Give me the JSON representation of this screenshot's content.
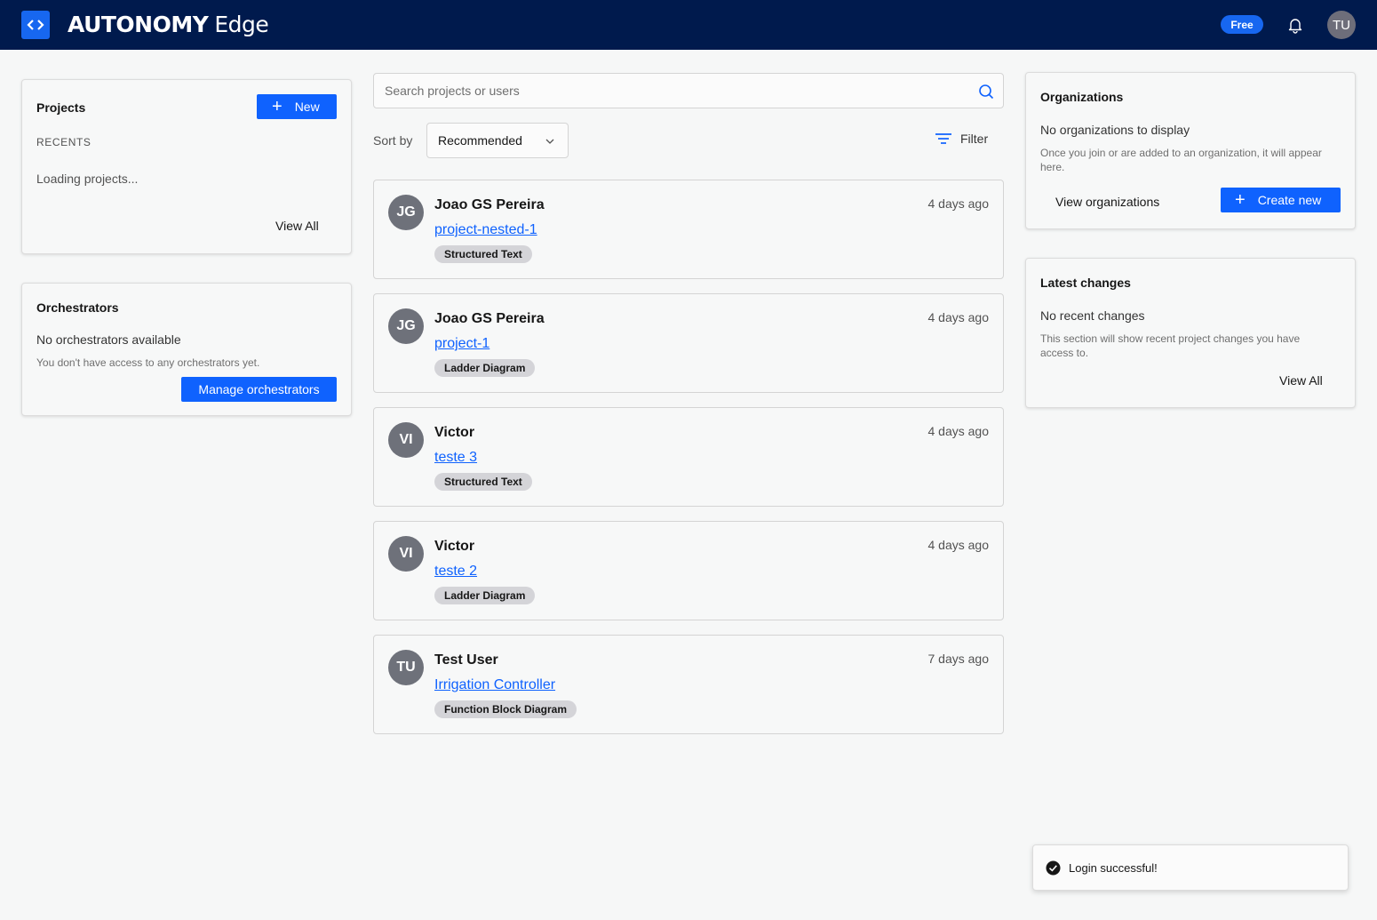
{
  "header": {
    "brand_strong": "AUTONOMY",
    "brand_light": "Edge",
    "plan_badge": "Free",
    "user_initials": "TU"
  },
  "projects_panel": {
    "title": "Projects",
    "new_label": "New",
    "recents_label": "RECENTS",
    "loading_text": "Loading projects...",
    "view_all": "View All"
  },
  "orchestrators_panel": {
    "title": "Orchestrators",
    "empty_title": "No orchestrators available",
    "empty_desc": "You don't have access to any orchestrators yet.",
    "manage_label": "Manage orchestrators"
  },
  "search": {
    "placeholder": "Search projects or users"
  },
  "sort": {
    "label": "Sort by",
    "selected": "Recommended"
  },
  "filter_label": "Filter",
  "feed": [
    {
      "initials": "JG",
      "name": "Joao GS Pereira",
      "project": "project-nested-1",
      "tag": "Structured Text",
      "time": "4 days ago"
    },
    {
      "initials": "JG",
      "name": "Joao GS Pereira",
      "project": "project-1",
      "tag": "Ladder Diagram",
      "time": "4 days ago"
    },
    {
      "initials": "VI",
      "name": "Victor",
      "project": "teste 3",
      "tag": "Structured Text",
      "time": "4 days ago"
    },
    {
      "initials": "VI",
      "name": "Victor",
      "project": "teste 2",
      "tag": "Ladder Diagram",
      "time": "4 days ago"
    },
    {
      "initials": "TU",
      "name": "Test User",
      "project": "Irrigation Controller",
      "tag": "Function Block Diagram",
      "time": "7 days ago"
    }
  ],
  "organizations_panel": {
    "title": "Organizations",
    "empty_title": "No organizations to display",
    "empty_desc": "Once you join or are added to an organization, it will appear here.",
    "view_label": "View organizations",
    "create_label": "Create new"
  },
  "latest_changes_panel": {
    "title": "Latest changes",
    "empty_title": "No recent changes",
    "empty_desc": "This section will show recent project changes you have access to.",
    "view_all": "View All"
  },
  "toast": {
    "message": "Login successful!"
  },
  "colors": {
    "header_bg": "#001a4d",
    "primary": "#0f62fe"
  }
}
